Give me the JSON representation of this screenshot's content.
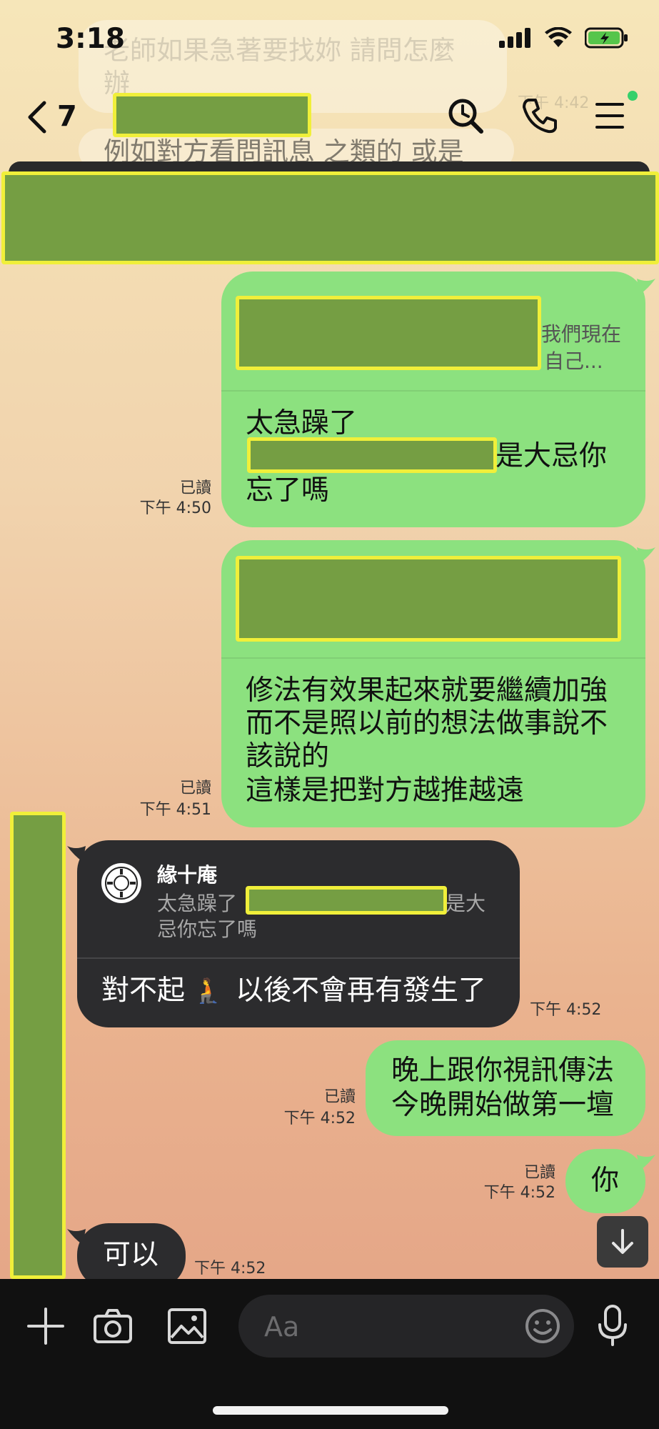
{
  "status_bar": {
    "time": "3:18"
  },
  "header": {
    "back_count": "7"
  },
  "background_snippets": {
    "line1": "老師如果急著要找妳 請問怎麼",
    "line2": "辦",
    "line3": "例如對方看問訊息 之類的 或是",
    "time": "下午 4:42"
  },
  "messages": {
    "m1": {
      "quote_tail_line1": "我們現在",
      "quote_tail_line2": "自己...",
      "line1": "太急躁了",
      "line2_tail": "是大忌你",
      "line3": "忘了嗎",
      "read": "已讀",
      "time": "下午 4:50"
    },
    "m2": {
      "line1": "修法有效果起來就要繼續加強",
      "line2": "而不是照以前的想法做事說不",
      "line3": "該說的",
      "line4": "這樣是把對方越推越遠",
      "read": "已讀",
      "time": "下午 4:51"
    },
    "m3": {
      "quote_name": "緣十庵",
      "quote_line1_head": "太急躁了",
      "quote_line1_tail": "是大",
      "quote_line2": "忌你忘了嗎",
      "body_part1": "對不起",
      "emoji": "🧎",
      "body_part2": "以後不會再有發生了",
      "time": "下午 4:52"
    },
    "m4": {
      "line1": "晚上跟你視訊傳法",
      "line2": "今晚開始做第一壇",
      "read": "已讀",
      "time": "下午 4:52"
    },
    "m5": {
      "text": "你",
      "read": "已讀",
      "time": "下午 4:52"
    },
    "m6": {
      "text": "可以",
      "time": "下午 4:52"
    }
  },
  "composer": {
    "placeholder": "Aa"
  },
  "icons": {
    "back": "chevron-left-icon",
    "search": "search-icon",
    "call": "phone-icon",
    "menu": "menu-icon",
    "add": "plus-icon",
    "camera": "camera-icon",
    "image": "image-icon",
    "emoji": "smiley-icon",
    "mic": "microphone-icon",
    "scroll": "arrow-down-icon"
  },
  "colors": {
    "outgoing_bubble": "#8ce17f",
    "incoming_bubble": "#2c2c2e",
    "redaction_fill": "#759e43",
    "redaction_outline": "#f0ef3a",
    "online_dot": "#36d06b"
  }
}
